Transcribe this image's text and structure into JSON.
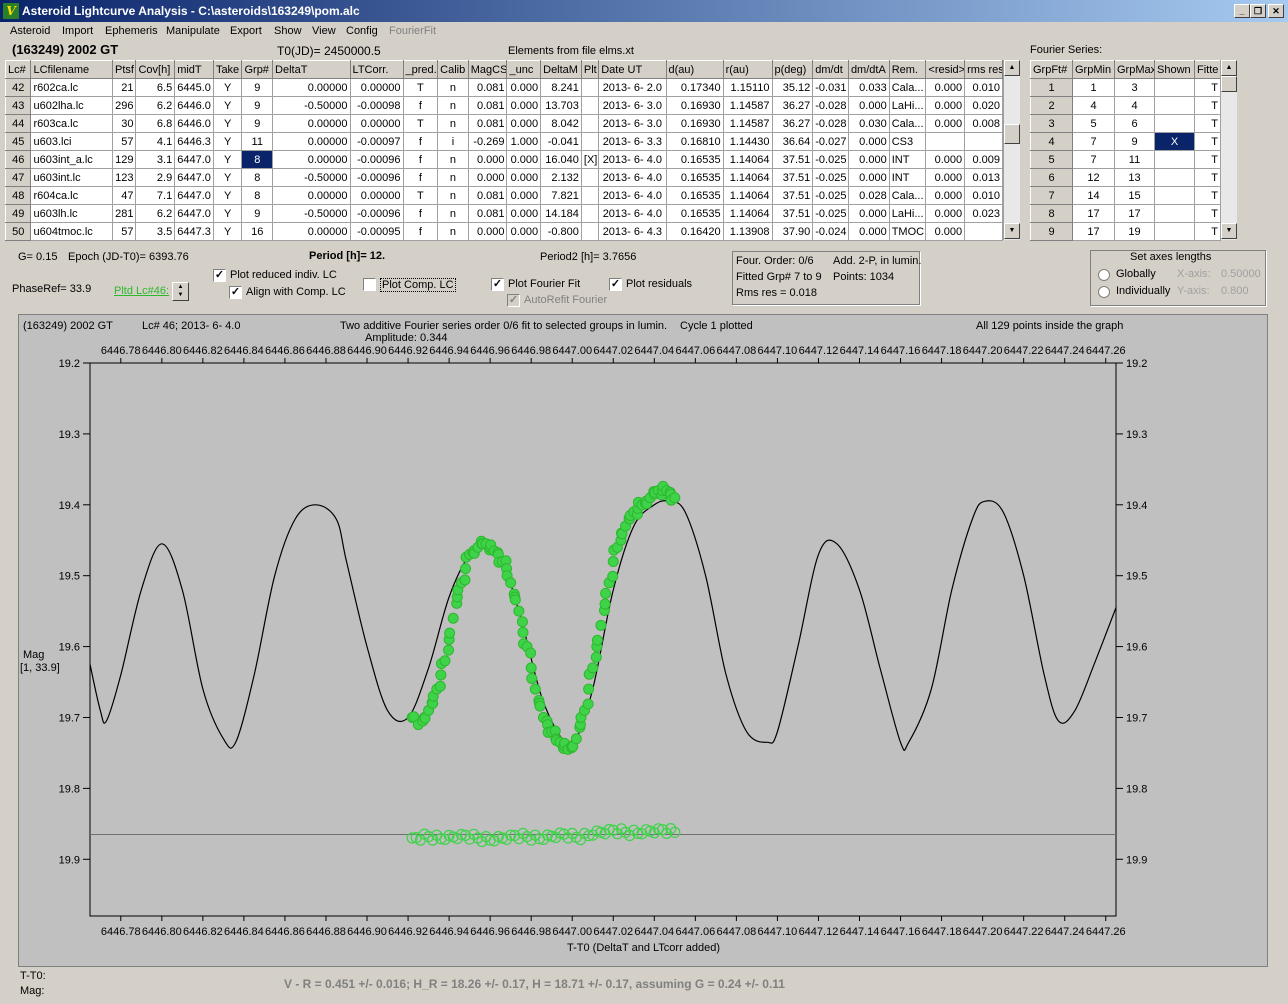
{
  "window": {
    "title": "Asteroid Lightcurve Analysis - C:\\asteroids\\163249\\pom.alc",
    "icon": "app-icon",
    "controls": [
      "minimize",
      "restore",
      "close"
    ]
  },
  "menu": [
    "Asteroid",
    "Import",
    "Ephemeris",
    "Manipulate",
    "Export",
    "Show",
    "View",
    "Config",
    "FourierFit"
  ],
  "header": {
    "object": "(163249) 2002 GT",
    "t0": "T0(JD)= 2450000.5",
    "elements": "Elements from file elms.xt",
    "fourier_title": "Fourier Series:"
  },
  "lctable": {
    "columns": [
      "Lc#",
      "LCfilename",
      "Ptsf",
      "Cov[h]",
      "midT",
      "Take",
      "Grp#",
      "DeltaT",
      "LTCorr.",
      "_pred.",
      "Calib",
      "MagCS",
      "_unc",
      "DeltaM",
      "Plt",
      "Date UT",
      "d(au)",
      "r(au)",
      "p(deg)",
      "dm/dt",
      "dm/dtA",
      "Rem.",
      "<resid>",
      "rms res"
    ],
    "rows": [
      [
        "42",
        "r602ca.lc",
        "21",
        "6.5",
        "6445.0",
        "Y",
        "9",
        "0.00000",
        "0.00000",
        "T",
        "n",
        "0.081",
        "0.000",
        "8.241",
        "",
        "2013- 6- 2.0",
        "0.17340",
        "1.15110",
        "35.12",
        "-0.031",
        "0.033",
        "Cala...",
        "0.000",
        "0.010"
      ],
      [
        "43",
        "u602lha.lc",
        "296",
        "6.2",
        "6446.0",
        "Y",
        "9",
        "-0.50000",
        "-0.00098",
        "f",
        "n",
        "0.081",
        "0.000",
        "13.703",
        "",
        "2013- 6- 3.0",
        "0.16930",
        "1.14587",
        "36.27",
        "-0.028",
        "0.000",
        "LaHi...",
        "0.000",
        "0.020"
      ],
      [
        "44",
        "r603ca.lc",
        "30",
        "6.8",
        "6446.0",
        "Y",
        "9",
        "0.00000",
        "0.00000",
        "T",
        "n",
        "0.081",
        "0.000",
        "8.042",
        "",
        "2013- 6- 3.0",
        "0.16930",
        "1.14587",
        "36.27",
        "-0.028",
        "0.030",
        "Cala...",
        "0.000",
        "0.008"
      ],
      [
        "45",
        "u603.lci",
        "57",
        "4.1",
        "6446.3",
        "Y",
        "11",
        "0.00000",
        "-0.00097",
        "f",
        "i",
        "-0.269",
        "1.000",
        "-0.041",
        "",
        "2013- 6- 3.3",
        "0.16810",
        "1.14430",
        "36.64",
        "-0.027",
        "0.000",
        "CS3",
        "",
        ""
      ],
      [
        "46",
        "u603int_a.lc",
        "129",
        "3.1",
        "6447.0",
        "Y",
        "8",
        "0.00000",
        "-0.00096",
        "f",
        "n",
        "0.000",
        "0.000",
        "16.040",
        "[X]",
        "2013- 6- 4.0",
        "0.16535",
        "1.14064",
        "37.51",
        "-0.025",
        "0.000",
        "INT",
        "0.000",
        "0.009"
      ],
      [
        "47",
        "u603int.lc",
        "123",
        "2.9",
        "6447.0",
        "Y",
        "8",
        "-0.50000",
        "-0.00096",
        "f",
        "n",
        "0.000",
        "0.000",
        "2.132",
        "",
        "2013- 6- 4.0",
        "0.16535",
        "1.14064",
        "37.51",
        "-0.025",
        "0.000",
        "INT",
        "0.000",
        "0.013"
      ],
      [
        "48",
        "r604ca.lc",
        "47",
        "7.1",
        "6447.0",
        "Y",
        "8",
        "0.00000",
        "0.00000",
        "T",
        "n",
        "0.081",
        "0.000",
        "7.821",
        "",
        "2013- 6- 4.0",
        "0.16535",
        "1.14064",
        "37.51",
        "-0.025",
        "0.028",
        "Cala...",
        "0.000",
        "0.010"
      ],
      [
        "49",
        "u603lh.lc",
        "281",
        "6.2",
        "6447.0",
        "Y",
        "9",
        "-0.50000",
        "-0.00096",
        "f",
        "n",
        "0.081",
        "0.000",
        "14.184",
        "",
        "2013- 6- 4.0",
        "0.16535",
        "1.14064",
        "37.51",
        "-0.025",
        "0.000",
        "LaHi...",
        "0.000",
        "0.023"
      ],
      [
        "50",
        "u604tmoc.lc",
        "57",
        "3.5",
        "6447.3",
        "Y",
        "16",
        "0.00000",
        "-0.00095",
        "f",
        "n",
        "0.000",
        "0.000",
        "-0.800",
        "",
        "2013- 6- 4.3",
        "0.16420",
        "1.13908",
        "37.90",
        "-0.024",
        "0.000",
        "TMOC.",
        "0.000",
        ""
      ]
    ]
  },
  "fouriertable": {
    "columns": [
      "GrpFt#",
      "GrpMin",
      "GrpMax",
      "Shown",
      "Fitte"
    ],
    "rows": [
      [
        "1",
        "1",
        "3",
        "",
        "T"
      ],
      [
        "2",
        "4",
        "4",
        "",
        "T"
      ],
      [
        "3",
        "5",
        "6",
        "",
        "T"
      ],
      [
        "4",
        "7",
        "9",
        "X",
        "T"
      ],
      [
        "5",
        "7",
        "11",
        "",
        "T"
      ],
      [
        "6",
        "12",
        "13",
        "",
        "T"
      ],
      [
        "7",
        "14",
        "15",
        "",
        "T"
      ],
      [
        "8",
        "17",
        "17",
        "",
        "T"
      ],
      [
        "9",
        "17",
        "19",
        "",
        "T"
      ]
    ]
  },
  "controls": {
    "g": "G= 0.15",
    "epoch": "Epoch (JD-T0)= 6393.76",
    "period": "Period [h]= 12.",
    "period2": "Period2 [h]= 3.7656",
    "phaseref": "PhaseRef= 33.9",
    "pltd": "Pltd Lc#46:",
    "cb_reduced": "Plot reduced indiv. LC",
    "cb_align": "Align with Comp. LC",
    "cb_comp": "Plot Comp. LC",
    "cb_fourier": "Plot Fourier Fit",
    "cb_autorefit": "AutoRefit Fourier",
    "cb_residuals": "Plot residuals",
    "info1": "Four. Order:  0/6",
    "info2": "Add. 2-P, in lumin.",
    "info3": "Fitted Grp# 7 to 9",
    "info4": "Points: 1034",
    "info5": "Rms res      = 0.018",
    "axes_title": "Set axes lengths",
    "r_globally": "Globally",
    "r_individually": "Individually",
    "xaxis": "X-axis:",
    "xval": "0.50000",
    "yaxis": "Y-axis:",
    "yval": "0.800"
  },
  "plot": {
    "h_object": "(163249) 2002 GT",
    "h_lc": "Lc# 46; 2013- 6- 4.0",
    "h_desc": "Two additive Fourier series order 0/6 fit to selected groups in lumin.",
    "h_amp": "Amplitude: 0.344",
    "h_cycle": "Cycle  1 plotted",
    "h_points": "All 129 points inside the graph",
    "ylabel": "Mag",
    "ylabel2": "[1, 33.9]",
    "xlabel": "T-T0 (DeltaT and LTcorr added)",
    "bottom1": "T-T0:",
    "bottom2": "Mag:",
    "result": "V - R = 0.451 +/- 0.016; H_R = 18.26 +/- 0.17, H = 18.71 +/- 0.17, assuming G = 0.24 +/- 0.11"
  },
  "chart_data": {
    "type": "scatter",
    "title": "Two additive Fourier series order 0/6 fit to selected groups in lumin.",
    "xlabel": "T-T0 (DeltaT and LTcorr added)",
    "ylabel": "Mag",
    "xlim": [
      6446.765,
      6447.265
    ],
    "ylim": [
      19.2,
      19.98
    ],
    "y_inverted": true,
    "x_ticks": [
      6446.78,
      6446.8,
      6446.82,
      6446.84,
      6446.86,
      6446.88,
      6446.9,
      6446.92,
      6446.94,
      6446.96,
      6446.98,
      6447.0,
      6447.02,
      6447.04,
      6447.06,
      6447.08,
      6447.1,
      6447.12,
      6447.14,
      6447.16,
      6447.18,
      6447.2,
      6447.22,
      6447.24,
      6447.26
    ],
    "y_ticks": [
      19.2,
      19.3,
      19.4,
      19.5,
      19.6,
      19.7,
      19.8,
      19.9
    ],
    "fourier_fit": {
      "x": [
        6446.765,
        6446.77,
        6446.773,
        6446.78,
        6446.79,
        6446.8,
        6446.81,
        6446.82,
        6446.83,
        6446.836,
        6446.845,
        6446.855,
        6446.865,
        6446.875,
        6446.885,
        6446.89,
        6446.9,
        6446.91,
        6446.92,
        6446.93,
        6446.94,
        6446.95,
        6446.958,
        6446.965,
        6446.975,
        6446.985,
        6446.995,
        6447.001,
        6447.01,
        6447.02,
        6447.03,
        6447.04,
        6447.047,
        6447.055,
        6447.065,
        6447.075,
        6447.085,
        6447.095,
        6447.1,
        6447.11,
        6447.12,
        6447.129,
        6447.14,
        6447.15,
        6447.16,
        6447.164,
        6447.175,
        6447.185,
        6447.195,
        6447.201,
        6447.21,
        6447.22,
        6447.23,
        6447.237,
        6447.245,
        6447.255,
        6447.265
      ],
      "mag": [
        19.625,
        19.69,
        19.705,
        19.64,
        19.52,
        19.455,
        19.52,
        19.66,
        19.73,
        19.735,
        19.64,
        19.5,
        19.42,
        19.4,
        19.42,
        19.48,
        19.6,
        19.69,
        19.7,
        19.63,
        19.53,
        19.47,
        19.455,
        19.47,
        19.56,
        19.67,
        19.73,
        19.735,
        19.66,
        19.52,
        19.43,
        19.4,
        19.395,
        19.41,
        19.5,
        19.64,
        19.72,
        19.735,
        19.72,
        19.6,
        19.47,
        19.455,
        19.52,
        19.63,
        19.735,
        19.735,
        19.66,
        19.52,
        19.42,
        19.395,
        19.41,
        19.5,
        19.64,
        19.705,
        19.69,
        19.62,
        19.545
      ]
    },
    "observations": {
      "x": [
        6446.922,
        6446.925,
        6446.928,
        6446.93,
        6446.932,
        6446.934,
        6446.936,
        6446.938,
        6446.94,
        6446.942,
        6446.944,
        6446.946,
        6446.948,
        6446.95,
        6446.952,
        6446.954,
        6446.956,
        6446.958,
        6446.96,
        6446.962,
        6446.964,
        6446.966,
        6446.968,
        6446.97,
        6446.972,
        6446.974,
        6446.976,
        6446.978,
        6446.98,
        6446.982,
        6446.984,
        6446.986,
        6446.988,
        6446.99,
        6446.992,
        6446.994,
        6446.996,
        6446.998,
        6447.0,
        6447.002,
        6447.004,
        6447.006,
        6447.008,
        6447.01,
        6447.012,
        6447.014,
        6447.016,
        6447.018,
        6447.02,
        6447.022,
        6447.024,
        6447.026,
        6447.028,
        6447.03,
        6447.032,
        6447.034,
        6447.036,
        6447.038,
        6447.04,
        6447.042,
        6447.044,
        6447.046,
        6447.048,
        6447.05
      ],
      "mag": [
        19.7,
        19.71,
        19.7,
        19.69,
        19.68,
        19.66,
        19.64,
        19.62,
        19.59,
        19.56,
        19.53,
        19.51,
        19.49,
        19.47,
        19.465,
        19.46,
        19.455,
        19.455,
        19.46,
        19.465,
        19.47,
        19.48,
        19.49,
        19.51,
        19.53,
        19.55,
        19.58,
        19.6,
        19.63,
        19.66,
        19.68,
        19.7,
        19.71,
        19.72,
        19.73,
        19.735,
        19.74,
        19.745,
        19.74,
        19.73,
        19.71,
        19.69,
        19.66,
        19.63,
        19.6,
        19.57,
        19.54,
        19.51,
        19.48,
        19.46,
        19.44,
        19.43,
        19.42,
        19.41,
        19.405,
        19.4,
        19.395,
        19.39,
        19.385,
        19.38,
        19.38,
        19.38,
        19.385,
        19.39
      ]
    },
    "residuals": {
      "x": [
        6446.922,
        6446.93,
        6446.938,
        6446.946,
        6446.954,
        6446.962,
        6446.97,
        6446.978,
        6446.986,
        6446.994,
        6447.002,
        6447.01,
        6447.018,
        6447.026,
        6447.034,
        6447.042,
        6447.05
      ],
      "mag": [
        19.87,
        19.868,
        19.872,
        19.865,
        19.87,
        19.874,
        19.866,
        19.868,
        19.872,
        19.863,
        19.869,
        19.866,
        19.858,
        19.862,
        19.864,
        19.857,
        19.862
      ]
    },
    "residual_baseline": 19.865
  }
}
